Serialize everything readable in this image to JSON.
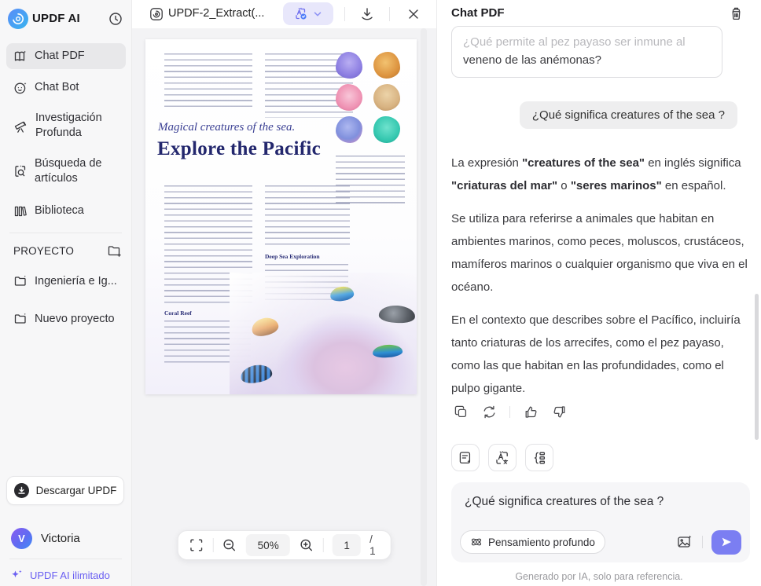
{
  "colors": {
    "accent_purple": "#7b7ef2",
    "pill_lavender": "#e8e7fb",
    "sidebar_bg": "#f7f7f8",
    "active_item_bg": "#e8e8ea",
    "pdf_heading_navy": "#23276d",
    "plan_link_purple": "#6a5ff2"
  },
  "sidebar": {
    "app_title": "UPDF AI",
    "menu": [
      {
        "label": "Chat PDF",
        "icon": "book-chat-icon"
      },
      {
        "label": "Chat Bot",
        "icon": "bot-face-icon"
      },
      {
        "label": "Investigación Profunda",
        "icon": "telescope-icon"
      },
      {
        "label": "Búsqueda de artículos",
        "icon": "article-search-icon"
      },
      {
        "label": "Biblioteca",
        "icon": "library-icon"
      }
    ],
    "project_label": "PROYECTO",
    "projects": [
      {
        "label": "Ingeniería e Ig..."
      },
      {
        "label": "Nuevo proyecto"
      }
    ],
    "download_button": "Descargar UPDF",
    "user_name": "Victoria",
    "user_initial": "V",
    "plan_label": "UPDF AI ilimitado"
  },
  "viewer": {
    "tab_title": "UPDF-2_Extract(...",
    "zoom_level": "50%",
    "current_page": "1",
    "page_total": "/ 1",
    "pdf_page": {
      "subtitle": "Magical creatures of the sea.",
      "title": "Explore the Pacific",
      "section1": "Coral Reef",
      "section2": "Deep Sea Exploration"
    }
  },
  "chat": {
    "header": "Chat PDF",
    "suggestion_line1": "¿Qué permite al pez payaso ser inmune al",
    "suggestion_line2": "veneno de las anémonas?",
    "user_message": "¿Qué significa creatures of the sea ?",
    "answer": {
      "p1": [
        "La expresión ",
        "\"creatures of the sea\"",
        " en inglés significa ",
        "\"criaturas del mar\"",
        " o ",
        "\"seres marinos\"",
        " en español."
      ],
      "p2": "Se utiliza para referirse a animales que habitan en ambientes marinos, como peces, moluscos, crustáceos, mamíferos marinos o cualquier organismo que viva en el océano.",
      "p3": "En el contexto que describes sobre el Pacífico, incluiría tanto criaturas de los arrecifes, como el pez payaso, como las que habitan en las profundidades, como el pulpo gigante."
    },
    "input_value": "¿Qué significa creatures of the sea ?",
    "deep_thought_label": "Pensamiento profundo",
    "disclaimer": "Generado por IA, solo para referencia."
  }
}
